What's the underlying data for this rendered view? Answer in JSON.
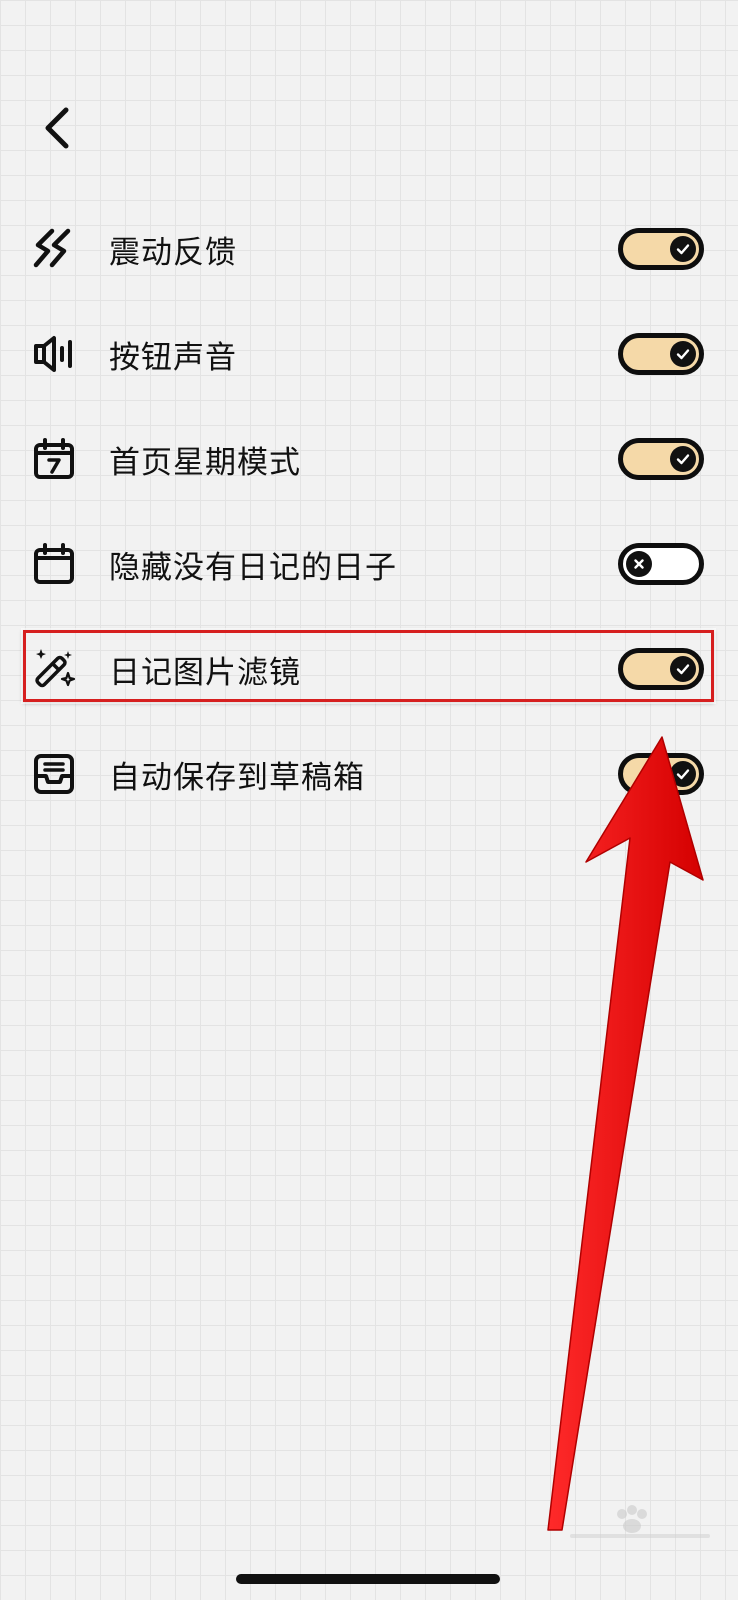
{
  "settings": {
    "items": [
      {
        "label": "震动反馈",
        "icon": "vibration-icon",
        "enabled": true
      },
      {
        "label": "按钮声音",
        "icon": "speaker-icon",
        "enabled": true
      },
      {
        "label": "首页星期模式",
        "icon": "calendar-week-icon",
        "enabled": true
      },
      {
        "label": "隐藏没有日记的日子",
        "icon": "calendar-icon",
        "enabled": false
      },
      {
        "label": "日记图片滤镜",
        "icon": "magic-wand-icon",
        "enabled": true
      },
      {
        "label": "自动保存到草稿箱",
        "icon": "inbox-tray-icon",
        "enabled": true
      }
    ]
  },
  "colors": {
    "toggle_on": "#f5d9a8",
    "toggle_border": "#0e0e0e",
    "highlight": "#d61f1f",
    "arrow": "#ee1111"
  }
}
